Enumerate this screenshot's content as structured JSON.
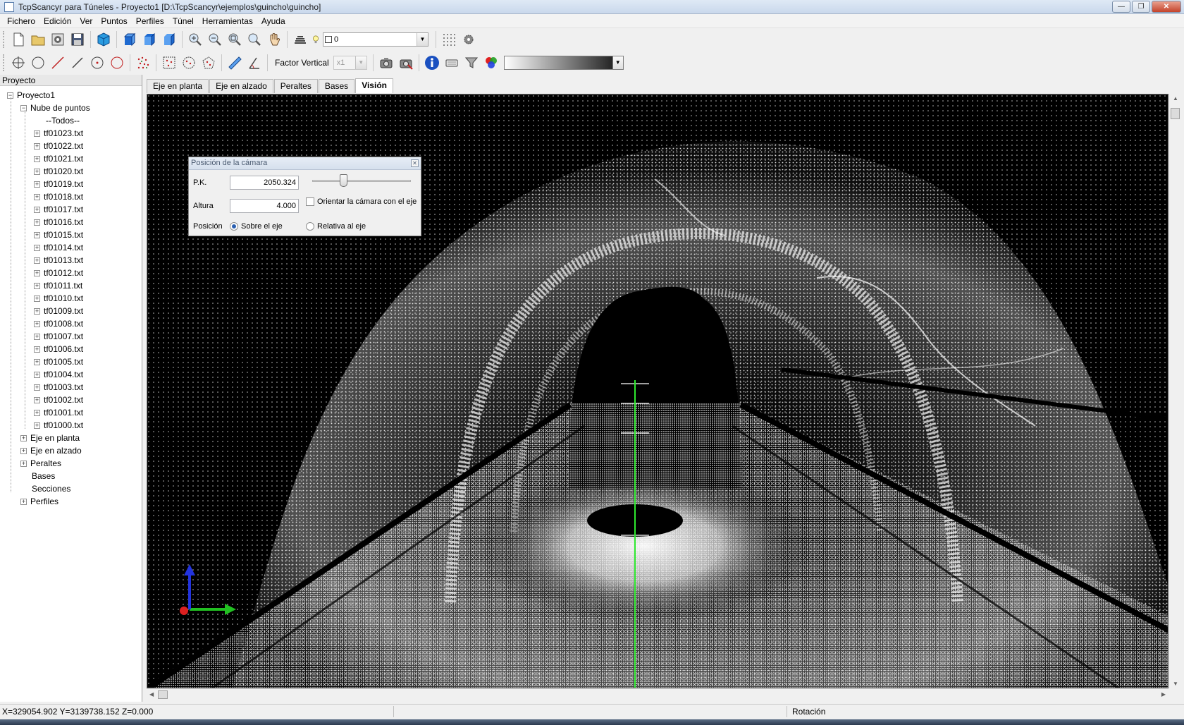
{
  "window": {
    "title": "TcpScancyr para Túneles - Proyecto1 [D:\\TcpScancyr\\ejemplos\\guincho\\guincho]",
    "buttons": {
      "minimize": "—",
      "maximize": "❐",
      "close": "✕"
    }
  },
  "menu": [
    "Fichero",
    "Edición",
    "Ver",
    "Puntos",
    "Perfiles",
    "Túnel",
    "Herramientas",
    "Ayuda"
  ],
  "toolbar1": {
    "layer_combo_value": "0"
  },
  "toolbar2": {
    "factor_vertical_label": "Factor Vertical",
    "factor_vertical_value": "x1"
  },
  "left_panel": {
    "header": "Proyecto",
    "tree": {
      "root": "Proyecto1",
      "point_cloud": "Nube de puntos",
      "all": "--Todos--",
      "files": [
        "tf01023.txt",
        "tf01022.txt",
        "tf01021.txt",
        "tf01020.txt",
        "tf01019.txt",
        "tf01018.txt",
        "tf01017.txt",
        "tf01016.txt",
        "tf01015.txt",
        "tf01014.txt",
        "tf01013.txt",
        "tf01012.txt",
        "tf01011.txt",
        "tf01010.txt",
        "tf01009.txt",
        "tf01008.txt",
        "tf01007.txt",
        "tf01006.txt",
        "tf01005.txt",
        "tf01004.txt",
        "tf01003.txt",
        "tf01002.txt",
        "tf01001.txt",
        "tf01000.txt"
      ],
      "other": [
        "Eje en planta",
        "Eje en alzado",
        "Peraltes",
        "Bases",
        "Secciones",
        "Perfiles"
      ]
    }
  },
  "tabs": [
    "Eje en planta",
    "Eje en alzado",
    "Peraltes",
    "Bases",
    "Visión"
  ],
  "active_tab": "Visión",
  "camera_dialog": {
    "title": "Posición de la cámara",
    "pk_label": "P.K.",
    "pk_value": "2050.324",
    "altura_label": "Altura",
    "altura_value": "4.000",
    "orient_label": "Orientar la cámara con el eje",
    "posicion_label": "Posición",
    "radio_sobre": "Sobre el eje",
    "radio_relativa": "Relativa al eje",
    "selected_position": "Sobre el eje",
    "orient_checked": false
  },
  "status": {
    "coords": "X=329054.902 Y=3139738.152 Z=0.000",
    "mode": "Rotación"
  },
  "colors": {
    "axis_line": "#2ee82e",
    "axis_x": "#21c021",
    "axis_y": "#2233dd",
    "axis_origin": "#dd2020",
    "point_cloud": "#ffffff"
  }
}
